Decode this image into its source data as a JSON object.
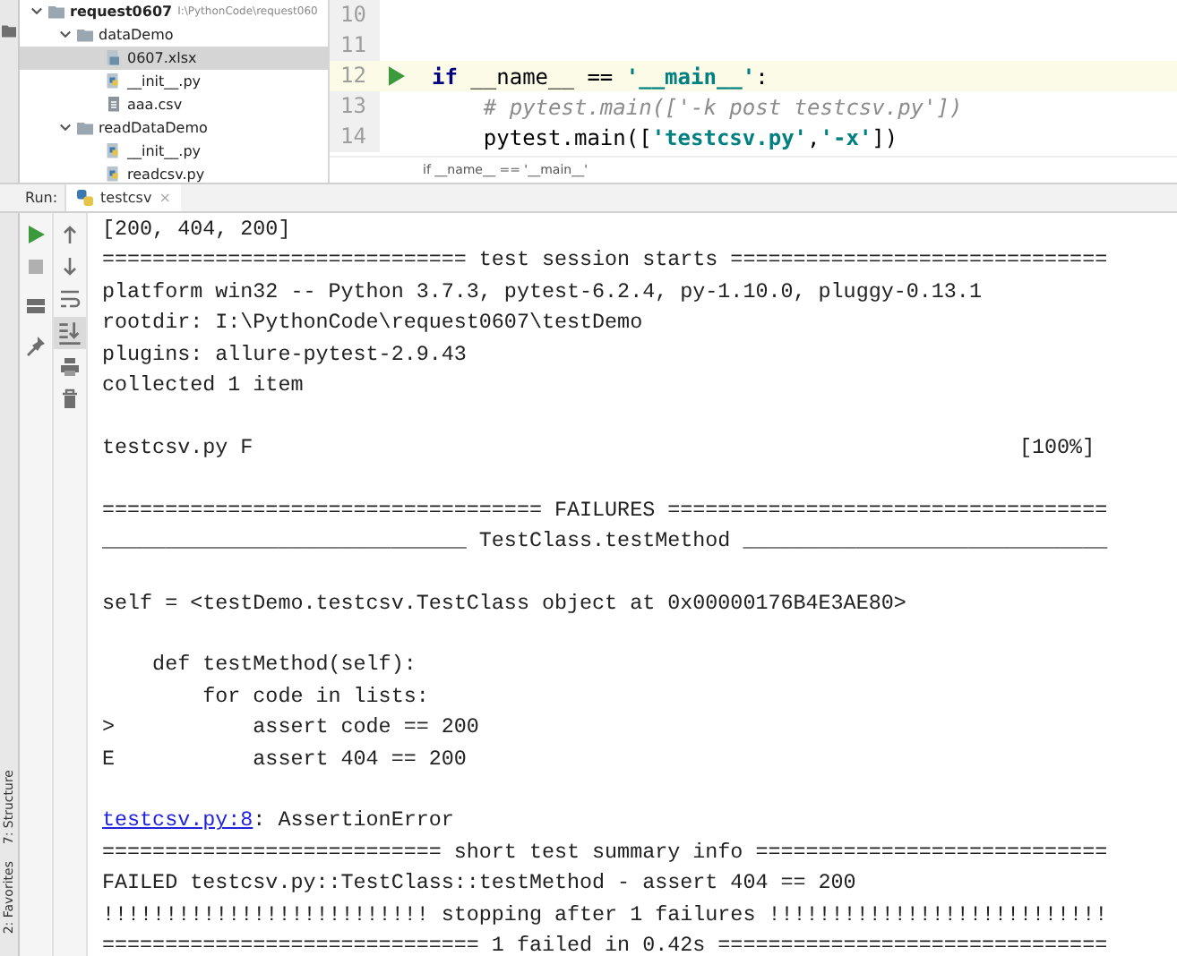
{
  "project_tree": [
    {
      "name": "request0607",
      "path": "I:\\PythonCode\\request060",
      "kind": "root",
      "expanded": true,
      "selected": false,
      "children": [
        {
          "name": "dataDemo",
          "kind": "folder",
          "expanded": true,
          "selected": false,
          "children": [
            {
              "name": "0607.xlsx",
              "kind": "sheet",
              "selected": true
            },
            {
              "name": "__init__.py",
              "kind": "python",
              "selected": false
            },
            {
              "name": "aaa.csv",
              "kind": "text",
              "selected": false
            }
          ]
        },
        {
          "name": "readDataDemo",
          "kind": "folder",
          "expanded": true,
          "selected": false,
          "children": [
            {
              "name": "__init__.py",
              "kind": "python",
              "selected": false
            },
            {
              "name": "readcsv.py",
              "kind": "python",
              "selected": false
            }
          ]
        }
      ]
    }
  ],
  "editor": {
    "lines": [
      {
        "number": "10",
        "current": false,
        "run_marker": false
      },
      {
        "number": "11",
        "current": false,
        "run_marker": false
      },
      {
        "number": "12",
        "current": true,
        "run_marker": true,
        "tokens": [
          {
            "kind": "keyword",
            "text": "if"
          },
          {
            "kind": "plain",
            "text": " __name__ == "
          },
          {
            "kind": "string",
            "text": "'__main__'"
          },
          {
            "kind": "plain",
            "text": ":"
          }
        ]
      },
      {
        "number": "13",
        "current": false,
        "run_marker": false,
        "tokens": [
          {
            "kind": "comment",
            "text": "    # pytest.main(['-k post testcsv.py'])"
          }
        ]
      },
      {
        "number": "14",
        "current": false,
        "run_marker": false,
        "tokens": [
          {
            "kind": "plain",
            "text": "    pytest.main(["
          },
          {
            "kind": "string",
            "text": "'testcsv.py'"
          },
          {
            "kind": "plain",
            "text": ","
          },
          {
            "kind": "string",
            "text": "'-x'"
          },
          {
            "kind": "plain",
            "text": "])"
          }
        ]
      }
    ],
    "breadcrumb": "if __name__ == '__main__'"
  },
  "run_bar": {
    "label": "Run:",
    "tabs": [
      {
        "label": "testcsv",
        "selected": true,
        "close": "×"
      }
    ]
  },
  "side_tools": [
    "7: Structure",
    "2: Favorites"
  ],
  "console": {
    "lines": [
      {
        "kind": "text",
        "text": "[200, 404, 200]"
      },
      {
        "kind": "text",
        "text": "============================= test session starts =============================="
      },
      {
        "kind": "text",
        "text": "platform win32 -- Python 3.7.3, pytest-6.2.4, py-1.10.0, pluggy-0.13.1"
      },
      {
        "kind": "text",
        "text": "rootdir: I:\\PythonCode\\request0607\\testDemo"
      },
      {
        "kind": "text",
        "text": "plugins: allure-pytest-2.9.43"
      },
      {
        "kind": "text",
        "text": "collected 1 item"
      },
      {
        "kind": "blank"
      },
      {
        "kind": "text",
        "text": "testcsv.py F                                                             [100%]"
      },
      {
        "kind": "blank"
      },
      {
        "kind": "text",
        "text": "=================================== FAILURES ==================================="
      },
      {
        "kind": "text",
        "text": "_____________________________ TestClass.testMethod _____________________________"
      },
      {
        "kind": "blank"
      },
      {
        "kind": "text",
        "text": "self = <testDemo.testcsv.TestClass object at 0x00000176B4E3AE80>"
      },
      {
        "kind": "blank"
      },
      {
        "kind": "text",
        "text": "    def testMethod(self):"
      },
      {
        "kind": "text",
        "text": "        for code in lists:"
      },
      {
        "kind": "text",
        "text": ">           assert code == 200"
      },
      {
        "kind": "text",
        "text": "E           assert 404 == 200"
      },
      {
        "kind": "blank"
      },
      {
        "kind": "link",
        "link": "testcsv.py:8",
        "text": ": AssertionError"
      },
      {
        "kind": "text",
        "text": "=========================== short test summary info ============================"
      },
      {
        "kind": "text",
        "text": "FAILED testcsv.py::TestClass::testMethod - assert 404 == 200"
      },
      {
        "kind": "text",
        "text": "!!!!!!!!!!!!!!!!!!!!!!!!!! stopping after 1 failures !!!!!!!!!!!!!!!!!!!!!!!!!!!"
      },
      {
        "kind": "text",
        "text": "============================== 1 failed in 0.42s ==============================="
      }
    ]
  }
}
